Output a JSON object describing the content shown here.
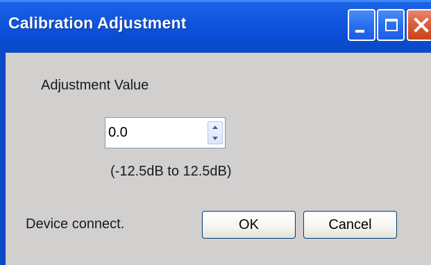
{
  "window": {
    "title": "Calibration Adjustment",
    "buttons": {
      "minimize_icon": "minimize-icon",
      "maximize_icon": "maximize-icon",
      "close_icon": "close-icon"
    }
  },
  "form": {
    "adjustment_label": "Adjustment Value",
    "adjustment_value": "0.0",
    "range_text": "(-12.5dB to 12.5dB)"
  },
  "footer": {
    "status": "Device connect.",
    "ok_label": "OK",
    "cancel_label": "Cancel"
  },
  "colors": {
    "titlebar": "#0a4dd3",
    "close_button": "#d95c38",
    "dialog_background": "#d2cfcf"
  }
}
